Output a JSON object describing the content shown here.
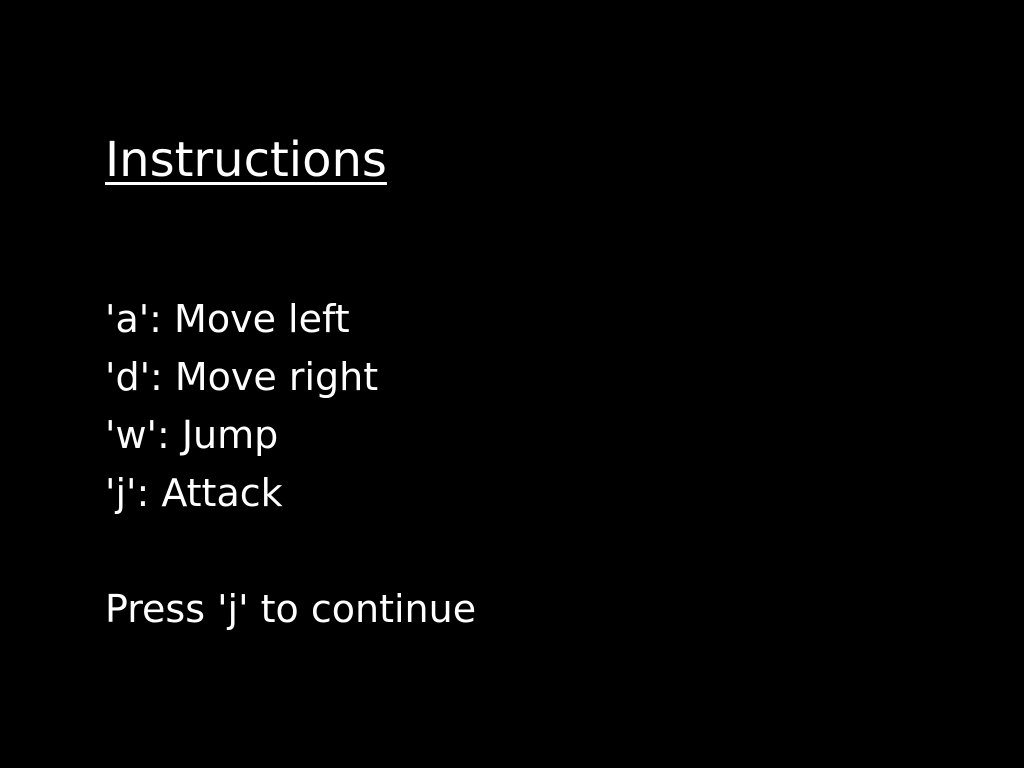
{
  "screen": {
    "title": "Instructions",
    "controls": [
      {
        "text": "'a': Move left"
      },
      {
        "text": "'d': Move right"
      },
      {
        "text": "'w': Jump"
      },
      {
        "text": "'j': Attack"
      }
    ],
    "prompt": "Press 'j' to continue"
  },
  "colors": {
    "background": "#000000",
    "text": "#ffffff"
  }
}
